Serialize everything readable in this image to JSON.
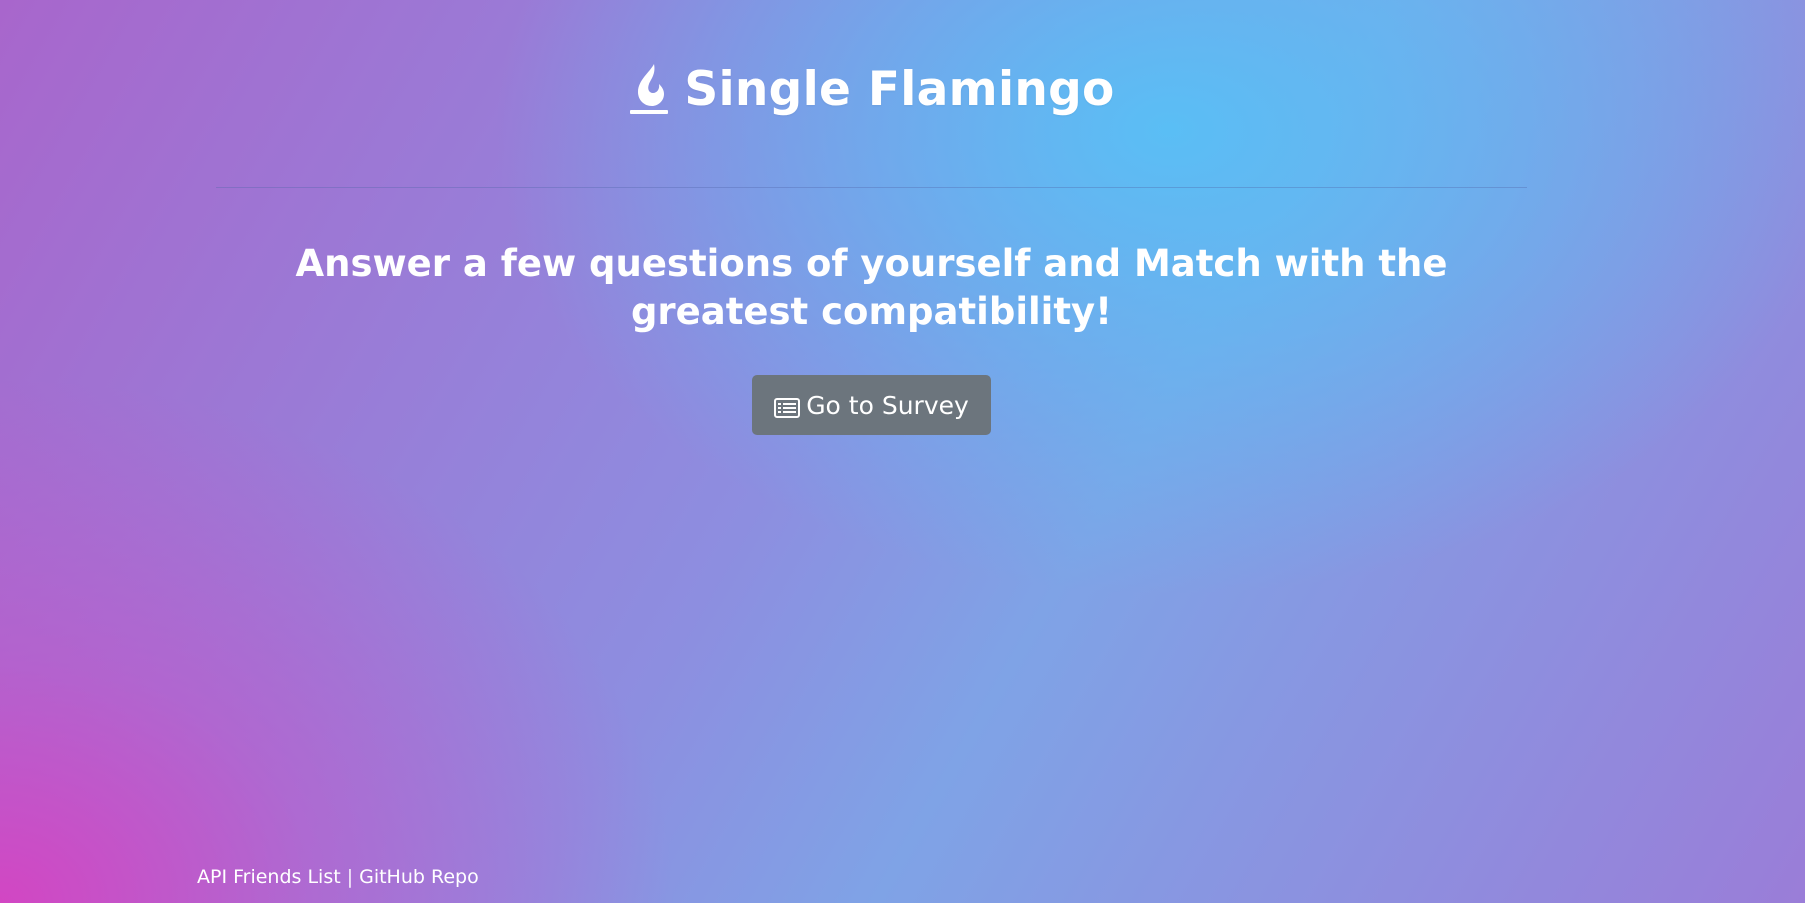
{
  "header": {
    "title": "Single Flamingo",
    "logo_icon": "fire-icon"
  },
  "main": {
    "tagline": "Answer a few questions of yourself and Match with the greatest compatibility!",
    "survey_button": {
      "label": "Go to Survey",
      "icon": "list-alt-icon"
    }
  },
  "footer": {
    "links": [
      {
        "label": "API Friends List"
      },
      {
        "label": "GitHub Repo"
      }
    ],
    "separator": "|"
  },
  "colors": {
    "button_bg": "#6c757d",
    "text": "#ffffff",
    "gradient_blue": "#5abef5",
    "gradient_pink": "#d246c3"
  }
}
